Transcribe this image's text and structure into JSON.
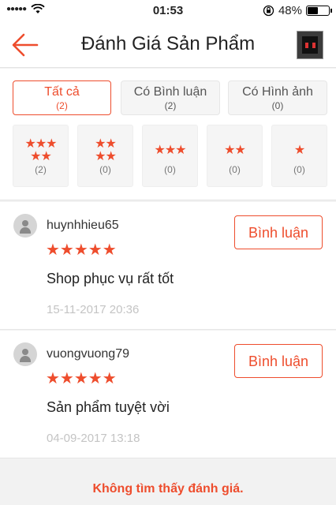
{
  "status_bar": {
    "time": "01:53",
    "battery": "48%",
    "battery_level": 0.48
  },
  "header": {
    "title": "Đánh Giá Sản Phẩm",
    "back_icon": "arrow-left-icon",
    "product_icon": "product-thumbnail"
  },
  "tabs": [
    {
      "label": "Tất cả",
      "count": "(2)",
      "active": true
    },
    {
      "label": "Có Bình luận",
      "count": "(2)",
      "active": false
    },
    {
      "label": "Có Hình ảnh",
      "count": "(0)",
      "active": false
    }
  ],
  "star_filters": [
    {
      "stars": 5,
      "count": "(2)"
    },
    {
      "stars": 4,
      "count": "(0)"
    },
    {
      "stars": 3,
      "count": "(0)"
    },
    {
      "stars": 2,
      "count": "(0)"
    },
    {
      "stars": 1,
      "count": "(0)"
    }
  ],
  "reviews": [
    {
      "username": "huynhhieu65",
      "rating": 5,
      "text": "Shop phục vụ rất tốt",
      "time": "15-11-2017 20:36",
      "comment_label": "Bình luận"
    },
    {
      "username": "vuongvuong79",
      "rating": 5,
      "text": "Sản phẩm tuyệt vời",
      "time": "04-09-2017 13:18",
      "comment_label": "Bình luận"
    }
  ],
  "footer": {
    "empty_note": "Không tìm thấy đánh giá."
  },
  "colors": {
    "accent": "#ee4d2d",
    "muted": "#c4c4c4"
  }
}
